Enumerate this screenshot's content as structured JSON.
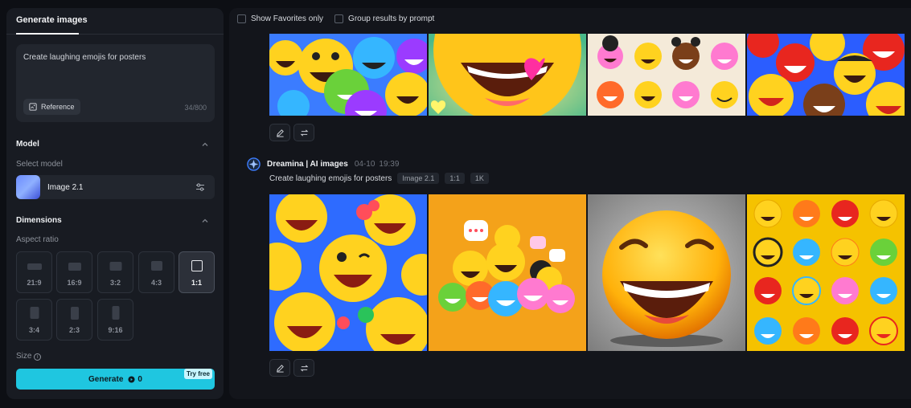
{
  "sidebar": {
    "tab_label": "Generate images",
    "prompt_text": "Create laughing emojis for posters",
    "reference_label": "Reference",
    "char_count": "34/800",
    "model_section": "Model",
    "select_model_label": "Select model",
    "model_name": "Image 2.1",
    "dimensions_section": "Dimensions",
    "aspect_ratio_label": "Aspect ratio",
    "ratios": [
      "21:9",
      "16:9",
      "3:2",
      "4:3",
      "1:1",
      "3:4",
      "2:3",
      "9:16"
    ],
    "selected_ratio": "1:1",
    "size_label": "Size",
    "generate_label": "Generate",
    "generate_credits": "0",
    "try_free_badge": "Try free"
  },
  "results": {
    "filter_favorites": "Show Favorites only",
    "filter_group": "Group results by prompt",
    "group2": {
      "source": "Dreamina | AI images",
      "date": "04-10",
      "time": "19:39",
      "prompt": "Create laughing emojis for posters",
      "tags": [
        "Image 2.1",
        "1:1",
        "1K"
      ]
    }
  },
  "colors": {
    "accent": "#1fc6e0",
    "panel": "#181b22",
    "background": "#0d0f14",
    "emoji_yellow": "#ffd21f"
  }
}
